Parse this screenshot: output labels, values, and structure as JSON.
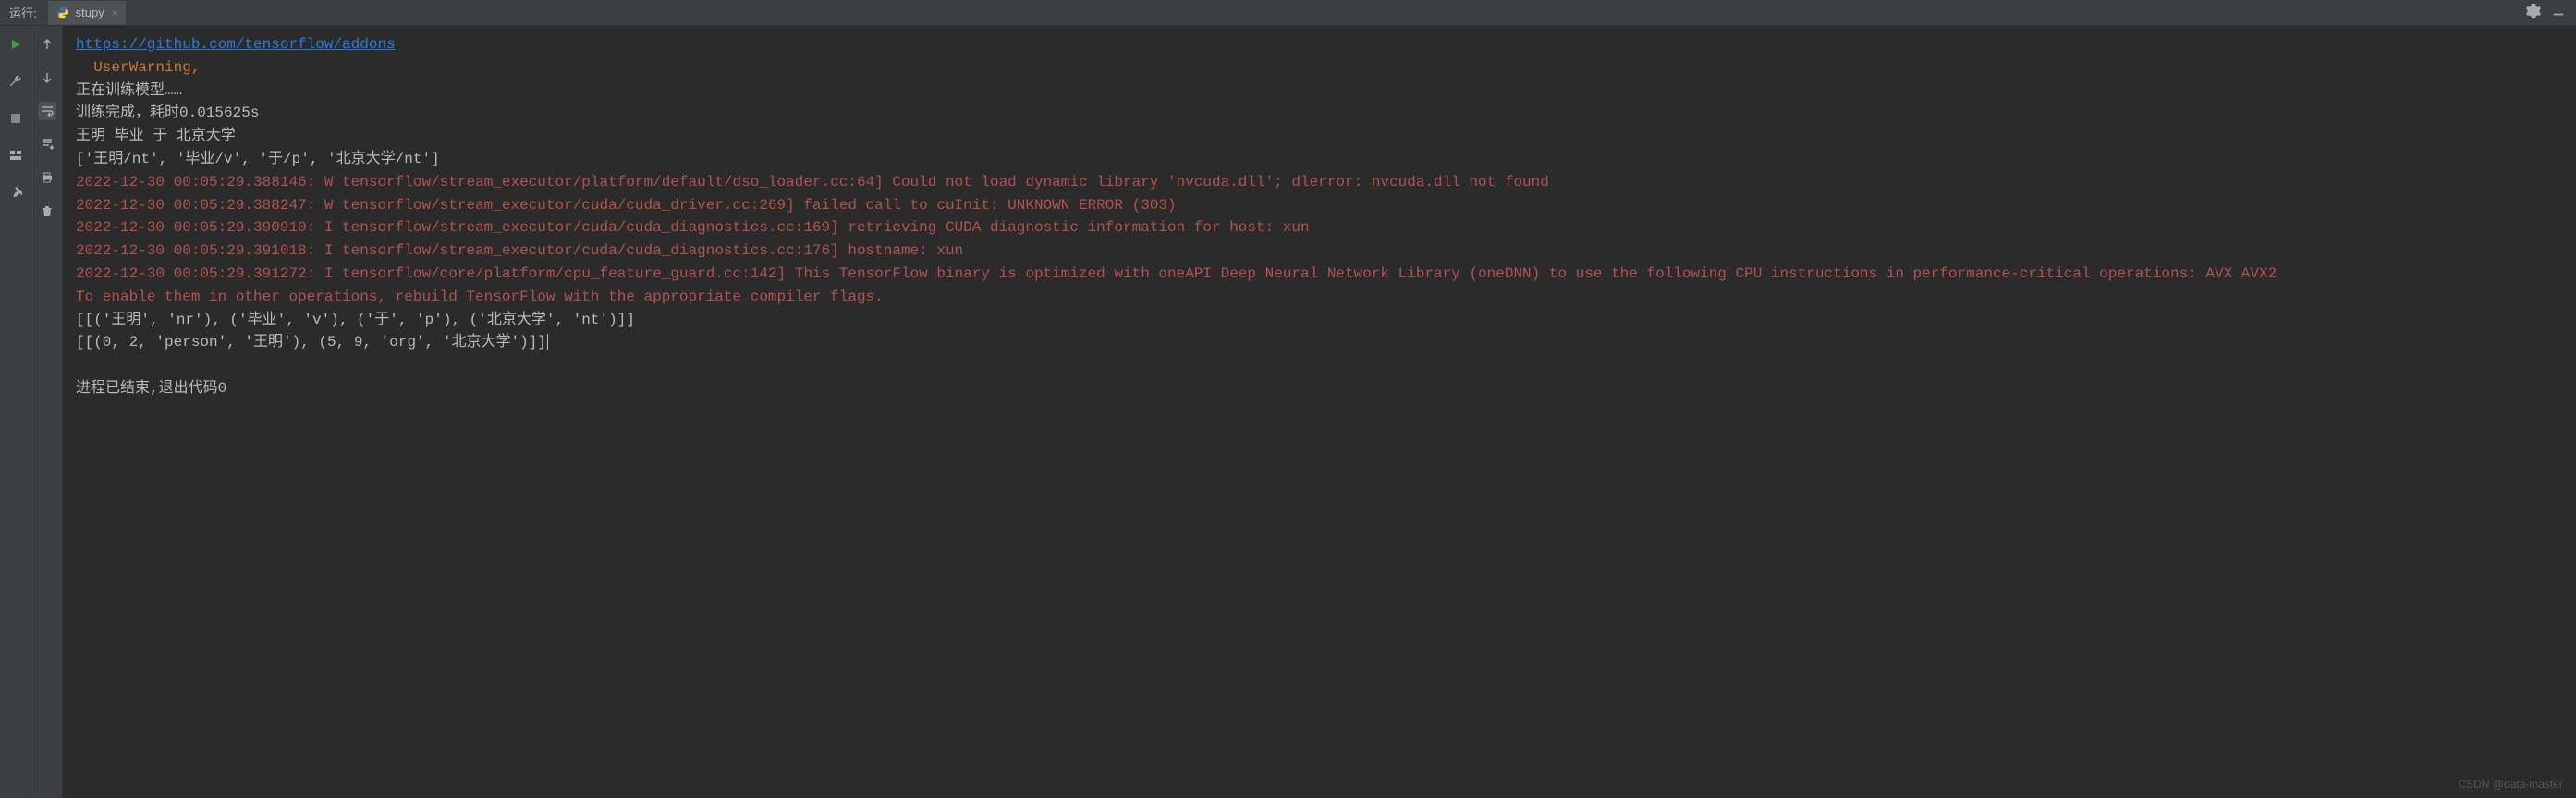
{
  "header": {
    "run_label": "运行:",
    "tab_name": "stupy"
  },
  "console": {
    "link_url": "https://github.com/tensorflow/addons",
    "warn_line": "  UserWarning,",
    "line_training": "正在训练模型……",
    "line_done": "训练完成，耗时0.015625s",
    "line_tokens": "王明 毕业 于 北京大学",
    "line_tagged": "['王明/nt', '毕业/v', '于/p', '北京大学/nt']",
    "err1": "2022-12-30 00:05:29.388146: W tensorflow/stream_executor/platform/default/dso_loader.cc:64] Could not load dynamic library 'nvcuda.dll'; dlerror: nvcuda.dll not found",
    "err2": "2022-12-30 00:05:29.388247: W tensorflow/stream_executor/cuda/cuda_driver.cc:269] failed call to cuInit: UNKNOWN ERROR (303)",
    "err3": "2022-12-30 00:05:29.390910: I tensorflow/stream_executor/cuda/cuda_diagnostics.cc:169] retrieving CUDA diagnostic information for host: xun",
    "err4": "2022-12-30 00:05:29.391018: I tensorflow/stream_executor/cuda/cuda_diagnostics.cc:176] hostname: xun",
    "err5": "2022-12-30 00:05:29.391272: I tensorflow/core/platform/cpu_feature_guard.cc:142] This TensorFlow binary is optimized with oneAPI Deep Neural Network Library (oneDNN) to use the following CPU instructions in performance-critical operations:  AVX AVX2",
    "err6": "To enable them in other operations, rebuild TensorFlow with the appropriate compiler flags.",
    "out1": "[[('王明', 'nr'), ('毕业', 'v'), ('于', 'p'), ('北京大学', 'nt')]]",
    "out2": "[[(0, 2, 'person', '王明'), (5, 9, 'org', '北京大学')]]",
    "exit_line": "进程已结束,退出代码0"
  },
  "watermark": "CSDN @data-master"
}
